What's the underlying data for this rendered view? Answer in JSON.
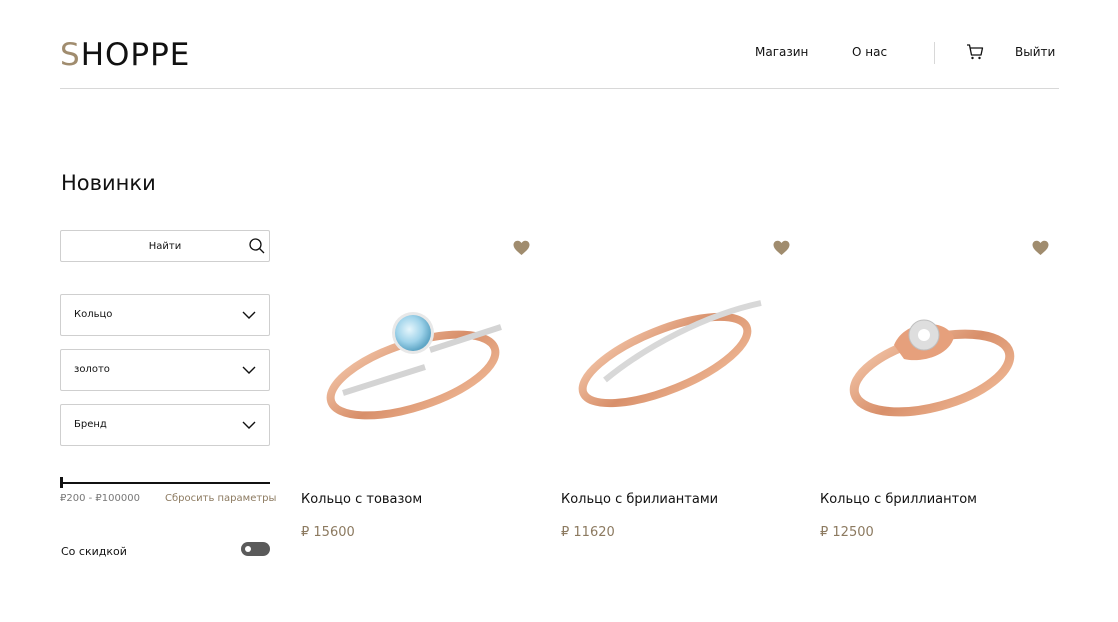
{
  "header": {
    "logo_first": "S",
    "logo_rest": "HOPPE",
    "nav": {
      "shop": "Магазин",
      "about": "О нас",
      "login": "Выйти"
    },
    "cart_icon": "cart-icon"
  },
  "title": "Новинки",
  "sidebar": {
    "search_placeholder": "Найти",
    "filters": [
      {
        "value": "Кольцо"
      },
      {
        "value": "золото"
      },
      {
        "value": "Бренд"
      }
    ],
    "price_range": "₽200 - ₽100000",
    "reset_label": "Сбросить параметры",
    "discount_label": "Со скидкой",
    "discount_enabled": false
  },
  "products": [
    {
      "name": "Кольцо с товазом",
      "price": "₽ 15600",
      "stone": "topaz"
    },
    {
      "name": "Кольцо с брилиантами",
      "price": "₽ 11620",
      "stone": "diamonds-band"
    },
    {
      "name": "Кольцо с бриллиантом",
      "price": "₽ 12500",
      "stone": "diamond"
    }
  ],
  "colors": {
    "accent": "#a08c6e",
    "price": "#8c7a60",
    "gold": "#e0a27e",
    "toggle": "#5a5a5a"
  }
}
